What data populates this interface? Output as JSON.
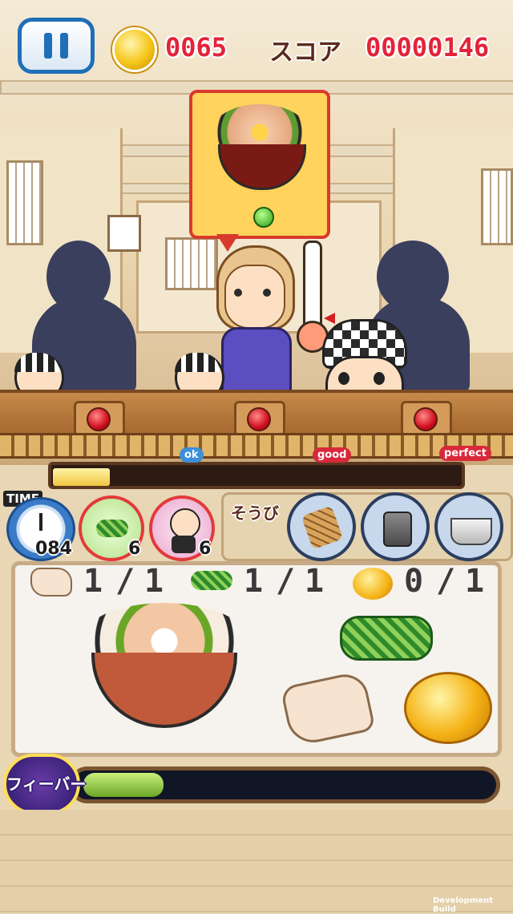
{
  "hud": {
    "coins": "0065",
    "score_label": "スコア",
    "score": "00000146"
  },
  "progress": {
    "level": 0.14,
    "markers": [
      "ok",
      "good",
      "perfect"
    ]
  },
  "timer": {
    "label": "TIME",
    "value": "084"
  },
  "items": [
    {
      "name": "green-onion-item",
      "count": "6"
    },
    {
      "name": "helper-item",
      "count": "6"
    }
  ],
  "equipment": {
    "label": "そうび",
    "slots": [
      "bamboo-scoop-icon",
      "steamer-pot-icon",
      "cooking-pot-icon"
    ]
  },
  "ingredients": [
    {
      "icon": "pork-slice-icon",
      "done": "1",
      "sep": "/",
      "total": "1"
    },
    {
      "icon": "green-onion-icon",
      "done": "1",
      "sep": "/",
      "total": "1"
    },
    {
      "icon": "egg-yolk-icon",
      "done": "0",
      "sep": "/",
      "total": "1"
    }
  ],
  "fever": {
    "label": "フィーバー",
    "level": 0.2
  },
  "footer": {
    "build": "Development Build"
  },
  "colors": {
    "accent_red": "#e2243a",
    "pause_blue": "#1f6fb8",
    "bubble_yellow": "#ffd35c",
    "fever_green": "#6aa626"
  }
}
